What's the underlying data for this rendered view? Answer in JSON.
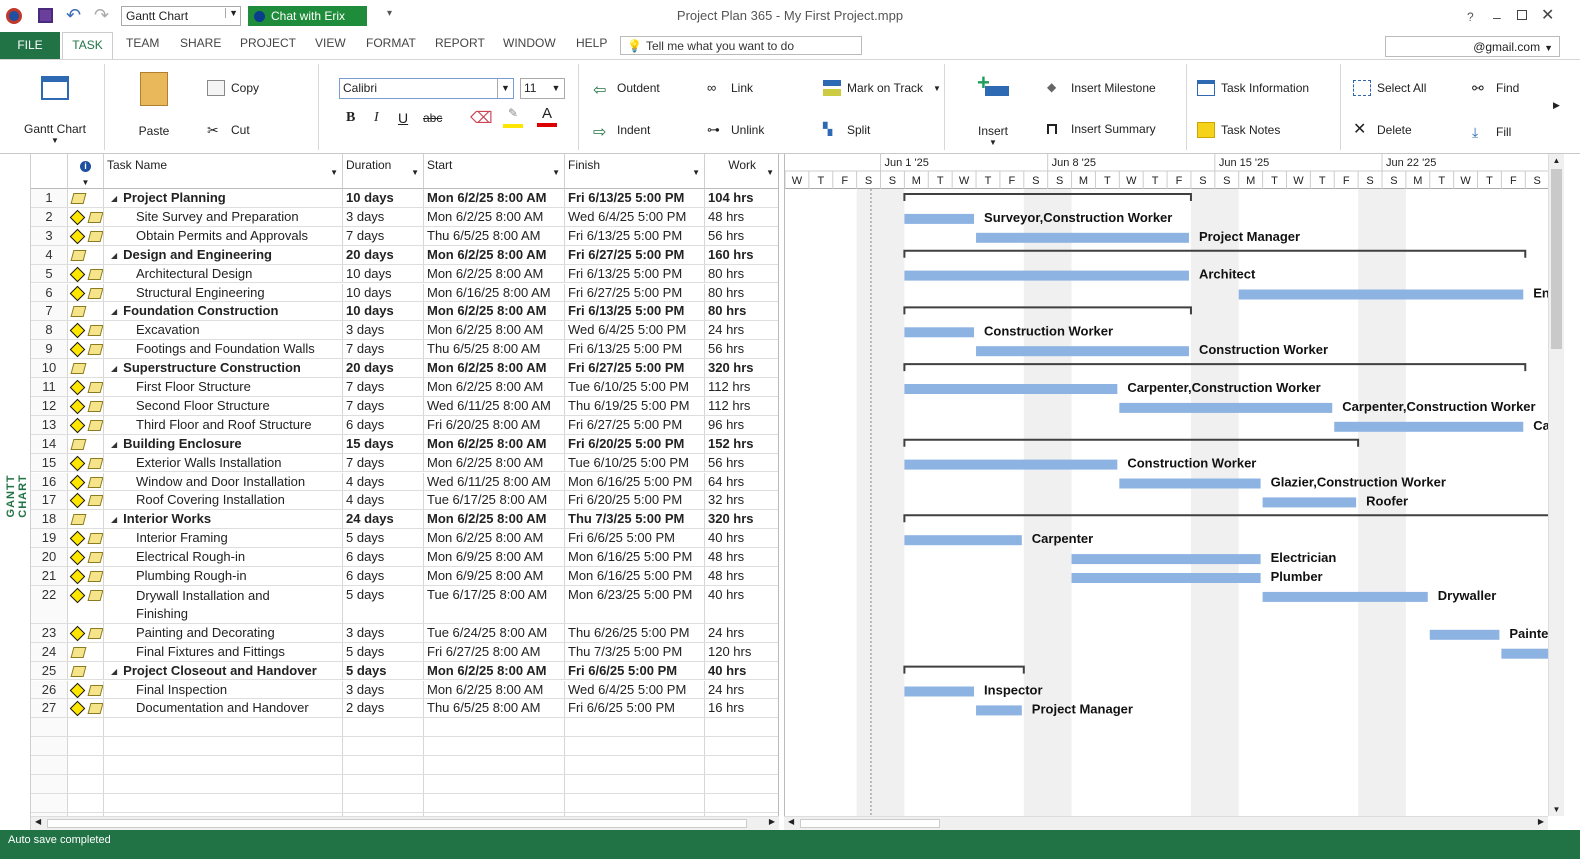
{
  "window": {
    "title": "Project Plan 365 - My First Project.mpp",
    "view_select": "Gantt Chart",
    "chat_button": "Chat with Erix",
    "help": "?"
  },
  "menu": {
    "file": "FILE",
    "tabs": [
      "TASK",
      "TEAM",
      "SHARE",
      "PROJECT",
      "VIEW",
      "FORMAT",
      "REPORT",
      "WINDOW",
      "HELP"
    ],
    "tell_me": "Tell me what you want to do",
    "account": "@gmail.com"
  },
  "ribbon": {
    "gantt_chart": "Gantt Chart",
    "paste": "Paste",
    "copy": "Copy",
    "cut": "Cut",
    "font": "Calibri",
    "font_size": "11",
    "outdent": "Outdent",
    "indent": "Indent",
    "link": "Link",
    "unlink": "Unlink",
    "mark_on_track": "Mark on Track",
    "split": "Split",
    "insert": "Insert",
    "insert_milestone": "Insert Milestone",
    "insert_summary": "Insert Summary",
    "task_information": "Task Information",
    "task_notes": "Task Notes",
    "select_all": "Select All",
    "delete": "Delete",
    "find": "Find",
    "fill": "Fill"
  },
  "sidebar_label": "GANTT CHART",
  "columns": {
    "task": "Task Name",
    "duration": "Duration",
    "start": "Start",
    "finish": "Finish",
    "work": "Work"
  },
  "timescale": {
    "weeks": [
      "Jun 1 '25",
      "Jun 8 '25",
      "Jun 15 '25",
      "Jun 22 '25"
    ],
    "days": [
      "W",
      "T",
      "F",
      "S",
      "S",
      "M",
      "T",
      "W",
      "T",
      "F",
      "S",
      "S",
      "M",
      "T",
      "W",
      "T",
      "F",
      "S",
      "S",
      "M",
      "T",
      "W",
      "T",
      "F",
      "S",
      "S",
      "M",
      "T",
      "W",
      "T",
      "F",
      "S"
    ]
  },
  "tasks": [
    {
      "id": "1",
      "name": "Project Planning",
      "duration": "10 days",
      "start": "Mon 6/2/25 8:00 AM",
      "finish": "Fri 6/13/25 5:00 PM",
      "work": "104 hrs",
      "summary": true,
      "s": 0,
      "e": 12,
      "label": ""
    },
    {
      "id": "2",
      "name": "Site Survey and Preparation",
      "duration": "3 days",
      "start": "Mon 6/2/25 8:00 AM",
      "finish": "Wed 6/4/25 5:00 PM",
      "work": "48 hrs",
      "summary": false,
      "s": 0,
      "e": 3,
      "label": "Surveyor,Construction Worker"
    },
    {
      "id": "3",
      "name": "Obtain Permits and Approvals",
      "duration": "7 days",
      "start": "Thu 6/5/25 8:00 AM",
      "finish": "Fri 6/13/25 5:00 PM",
      "work": "56 hrs",
      "summary": false,
      "s": 3,
      "e": 12,
      "label": "Project Manager"
    },
    {
      "id": "4",
      "name": "Design and Engineering",
      "duration": "20 days",
      "start": "Mon 6/2/25 8:00 AM",
      "finish": "Fri 6/27/25 5:00 PM",
      "work": "160 hrs",
      "summary": true,
      "s": 0,
      "e": 26,
      "label": ""
    },
    {
      "id": "5",
      "name": "Architectural Design",
      "duration": "10 days",
      "start": "Mon 6/2/25 8:00 AM",
      "finish": "Fri 6/13/25 5:00 PM",
      "work": "80 hrs",
      "summary": false,
      "s": 0,
      "e": 12,
      "label": "Architect"
    },
    {
      "id": "6",
      "name": "Structural Engineering",
      "duration": "10 days",
      "start": "Mon 6/16/25 8:00 AM",
      "finish": "Fri 6/27/25 5:00 PM",
      "work": "80 hrs",
      "summary": false,
      "s": 14,
      "e": 26,
      "label": "En"
    },
    {
      "id": "7",
      "name": "Foundation Construction",
      "duration": "10 days",
      "start": "Mon 6/2/25 8:00 AM",
      "finish": "Fri 6/13/25 5:00 PM",
      "work": "80 hrs",
      "summary": true,
      "s": 0,
      "e": 12,
      "label": ""
    },
    {
      "id": "8",
      "name": "Excavation",
      "duration": "3 days",
      "start": "Mon 6/2/25 8:00 AM",
      "finish": "Wed 6/4/25 5:00 PM",
      "work": "24 hrs",
      "summary": false,
      "s": 0,
      "e": 3,
      "label": "Construction Worker"
    },
    {
      "id": "9",
      "name": "Footings and Foundation Walls",
      "duration": "7 days",
      "start": "Thu 6/5/25 8:00 AM",
      "finish": "Fri 6/13/25 5:00 PM",
      "work": "56 hrs",
      "summary": false,
      "s": 3,
      "e": 12,
      "label": "Construction Worker"
    },
    {
      "id": "10",
      "name": "Superstructure Construction",
      "duration": "20 days",
      "start": "Mon 6/2/25 8:00 AM",
      "finish": "Fri 6/27/25 5:00 PM",
      "work": "320 hrs",
      "summary": true,
      "s": 0,
      "e": 26,
      "label": ""
    },
    {
      "id": "11",
      "name": "First Floor Structure",
      "duration": "7 days",
      "start": "Mon 6/2/25 8:00 AM",
      "finish": "Tue 6/10/25 5:00 PM",
      "work": "112 hrs",
      "summary": false,
      "s": 0,
      "e": 9,
      "label": "Carpenter,Construction Worker"
    },
    {
      "id": "12",
      "name": "Second Floor Structure",
      "duration": "7 days",
      "start": "Wed 6/11/25 8:00 AM",
      "finish": "Thu 6/19/25 5:00 PM",
      "work": "112 hrs",
      "summary": false,
      "s": 9,
      "e": 18,
      "label": "Carpenter,Construction Worker"
    },
    {
      "id": "13",
      "name": "Third Floor and Roof Structure",
      "duration": "6 days",
      "start": "Fri 6/20/25 8:00 AM",
      "finish": "Fri 6/27/25 5:00 PM",
      "work": "96 hrs",
      "summary": false,
      "s": 18,
      "e": 26,
      "label": "Ca"
    },
    {
      "id": "14",
      "name": "Building Enclosure",
      "duration": "15 days",
      "start": "Mon 6/2/25 8:00 AM",
      "finish": "Fri 6/20/25 5:00 PM",
      "work": "152 hrs",
      "summary": true,
      "s": 0,
      "e": 19,
      "label": ""
    },
    {
      "id": "15",
      "name": "Exterior Walls Installation",
      "duration": "7 days",
      "start": "Mon 6/2/25 8:00 AM",
      "finish": "Tue 6/10/25 5:00 PM",
      "work": "56 hrs",
      "summary": false,
      "s": 0,
      "e": 9,
      "label": "Construction Worker"
    },
    {
      "id": "16",
      "name": "Window and Door Installation",
      "duration": "4 days",
      "start": "Wed 6/11/25 8:00 AM",
      "finish": "Mon 6/16/25 5:00 PM",
      "work": "64 hrs",
      "summary": false,
      "s": 9,
      "e": 15,
      "label": "Glazier,Construction Worker"
    },
    {
      "id": "17",
      "name": "Roof Covering Installation",
      "duration": "4 days",
      "start": "Tue 6/17/25 8:00 AM",
      "finish": "Fri 6/20/25 5:00 PM",
      "work": "32 hrs",
      "summary": false,
      "s": 15,
      "e": 19,
      "label": "Roofer"
    },
    {
      "id": "18",
      "name": "Interior Works",
      "duration": "24 days",
      "start": "Mon 6/2/25 8:00 AM",
      "finish": "Thu 7/3/25 5:00 PM",
      "work": "320 hrs",
      "summary": true,
      "s": 0,
      "e": 31,
      "label": ""
    },
    {
      "id": "19",
      "name": "Interior Framing",
      "duration": "5 days",
      "start": "Mon 6/2/25 8:00 AM",
      "finish": "Fri 6/6/25 5:00 PM",
      "work": "40 hrs",
      "summary": false,
      "s": 0,
      "e": 5,
      "label": "Carpenter"
    },
    {
      "id": "20",
      "name": "Electrical Rough-in",
      "duration": "6 days",
      "start": "Mon 6/9/25 8:00 AM",
      "finish": "Mon 6/16/25 5:00 PM",
      "work": "48 hrs",
      "summary": false,
      "s": 7,
      "e": 15,
      "label": "Electrician"
    },
    {
      "id": "21",
      "name": "Plumbing Rough-in",
      "duration": "6 days",
      "start": "Mon 6/9/25 8:00 AM",
      "finish": "Mon 6/16/25 5:00 PM",
      "work": "48 hrs",
      "summary": false,
      "s": 7,
      "e": 15,
      "label": "Plumber"
    },
    {
      "id": "22",
      "name": "Drywall Installation and Finishing",
      "duration": "5 days",
      "start": "Tue 6/17/25 8:00 AM",
      "finish": "Mon 6/23/25 5:00 PM",
      "work": "40 hrs",
      "summary": false,
      "s": 15,
      "e": 22,
      "label": "Drywaller"
    },
    {
      "id": "23",
      "name": "Painting and Decorating",
      "duration": "3 days",
      "start": "Tue 6/24/25 8:00 AM",
      "finish": "Thu 6/26/25 5:00 PM",
      "work": "24 hrs",
      "summary": false,
      "s": 22,
      "e": 25,
      "label": "Painte"
    },
    {
      "id": "24",
      "name": "Final Fixtures and Fittings",
      "duration": "5 days",
      "start": "Fri 6/27/25 8:00 AM",
      "finish": "Thu 7/3/25 5:00 PM",
      "work": "120 hrs",
      "summary": false,
      "s": 25,
      "e": 31,
      "label": ""
    },
    {
      "id": "25",
      "name": "Project Closeout and Handover",
      "duration": "5 days",
      "start": "Mon 6/2/25 8:00 AM",
      "finish": "Fri 6/6/25 5:00 PM",
      "work": "40 hrs",
      "summary": true,
      "s": 0,
      "e": 5,
      "label": ""
    },
    {
      "id": "26",
      "name": "Final Inspection",
      "duration": "3 days",
      "start": "Mon 6/2/25 8:00 AM",
      "finish": "Wed 6/4/25 5:00 PM",
      "work": "24 hrs",
      "summary": false,
      "s": 0,
      "e": 3,
      "label": "Inspector"
    },
    {
      "id": "27",
      "name": "Documentation and Handover",
      "duration": "2 days",
      "start": "Thu 6/5/25 8:00 AM",
      "finish": "Fri 6/6/25 5:00 PM",
      "work": "16 hrs",
      "summary": false,
      "s": 3,
      "e": 5,
      "label": "Project Manager"
    }
  ],
  "status": "Auto save completed",
  "colors": {
    "accent": "#217346",
    "bar": "#8db3e2",
    "summary": "#404040"
  }
}
